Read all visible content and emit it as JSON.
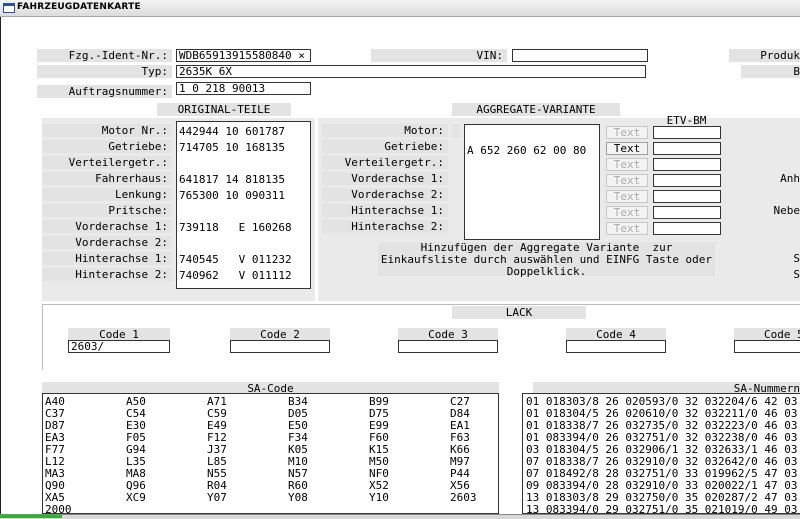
{
  "window": {
    "title": "FAHRZEUGDATENKARTE"
  },
  "header": {
    "fzg_ident_label": "Fzg.-Ident-Nr.:",
    "fzg_ident_value": "WDB65913915580840 ×",
    "vin_label": "VIN:",
    "vin_value": "",
    "typ_label": "Typ:",
    "typ_value": "2635K   6X",
    "auftrag_label": "Auftragsnummer:",
    "auftrag_value": "1 0 218 90013",
    "produkt_label": "Produk",
    "b_label": "B"
  },
  "original_teile": {
    "title": "ORIGINAL-TEILE",
    "rows": [
      {
        "label": "Motor Nr.:",
        "value": "442944 10 601787"
      },
      {
        "label": "Getriebe:",
        "value": "714705 10 168135"
      },
      {
        "label": "Verteilergetr.:",
        "value": ""
      },
      {
        "label": "Fahrerhaus:",
        "value": "641817 14 818135"
      },
      {
        "label": "Lenkung:",
        "value": "765300 10 090311"
      },
      {
        "label": "Pritsche:",
        "value": ""
      },
      {
        "label": "Vorderachse 1:",
        "value": "739118   E 160268"
      },
      {
        "label": "Vorderachse 2:",
        "value": ""
      },
      {
        "label": "Hinterachse 1:",
        "value": "740545   V 011232"
      },
      {
        "label": "Hinterachse 2:",
        "value": "740962   V 011112"
      }
    ]
  },
  "aggregate": {
    "title": "AGGREGATE-VARIANTE",
    "etv_title": "ETV-BM",
    "rows": [
      {
        "label": "Motor:",
        "value": "",
        "text_btn": "Text",
        "enabled": false
      },
      {
        "label": "Getriebe:",
        "value": "A 652 260 62 00 80",
        "text_btn": "Text",
        "enabled": true
      },
      {
        "label": "Verteilergetr.:",
        "value": "",
        "text_btn": "Text",
        "enabled": false
      },
      {
        "label": "Vorderachse 1:",
        "value": "",
        "text_btn": "Text",
        "enabled": false
      },
      {
        "label": "Vorderachse 2:",
        "value": "",
        "text_btn": "Text",
        "enabled": false
      },
      {
        "label": "Hinterachse 1:",
        "value": "",
        "text_btn": "Text",
        "enabled": false
      },
      {
        "label": "Hinterachse 2:",
        "value": "",
        "text_btn": "Text",
        "enabled": false
      }
    ],
    "note": "Hinzufügen der Aggregate Variante  zur\nEinkaufsliste durch auswählen und EINFG Taste oder\nDoppelklick."
  },
  "right_edge": [
    "Anh",
    "Nebe",
    "S",
    "S"
  ],
  "lack": {
    "title": "LACK",
    "codes": [
      {
        "label": "Code 1",
        "value": "2603/"
      },
      {
        "label": "Code 2",
        "value": ""
      },
      {
        "label": "Code 3",
        "value": ""
      },
      {
        "label": "Code 4",
        "value": ""
      },
      {
        "label": "Code 5",
        "value": ""
      }
    ]
  },
  "sa_code": {
    "title": "SA-Code",
    "items": [
      "A40",
      "A50",
      "A71",
      "B34",
      "B99",
      "C27",
      "C37",
      "C54",
      "C59",
      "D05",
      "D75",
      "D84",
      "D87",
      "E30",
      "E49",
      "E50",
      "E99",
      "EA1",
      "EA3",
      "F05",
      "F12",
      "F34",
      "F60",
      "F63",
      "F77",
      "G94",
      "J37",
      "K05",
      "K15",
      "K66",
      "L12",
      "L35",
      "L85",
      "M10",
      "M50",
      "M97",
      "MA3",
      "MA8",
      "N55",
      "N57",
      "NF0",
      "P44",
      "Q90",
      "Q96",
      "R04",
      "R60",
      "X52",
      "X56",
      "XA5",
      "XC9",
      "Y07",
      "Y08",
      "Y10",
      "2603",
      "2000"
    ]
  },
  "sa_nummern": {
    "title": "SA-Nummern",
    "rows": [
      "01 018303/8 26 020593/0 32 032204/6 42 03",
      "01 018304/5 26 020610/0 32 032211/0 46 03",
      "01 018338/7 26 032735/0 32 032223/0 46 03",
      "01 083394/0 26 032751/0 32 032238/0 46 03",
      "03 018304/5 26 032906/1 32 032633/1 46 03",
      "07 018338/7 26 032910/0 32 032642/0 46 03",
      "07 018492/8 28 032751/0 33 019962/5 47 03",
      "09 083394/0 28 032910/0 33 020022/1 47 03",
      "13 018303/8 29 032750/0 35 020287/2 47 03",
      "13 083394/0 29 032751/0 35 021019/0 49 03",
      "18 018338/7 29 032910/0 35 021019/0 49 03"
    ]
  }
}
